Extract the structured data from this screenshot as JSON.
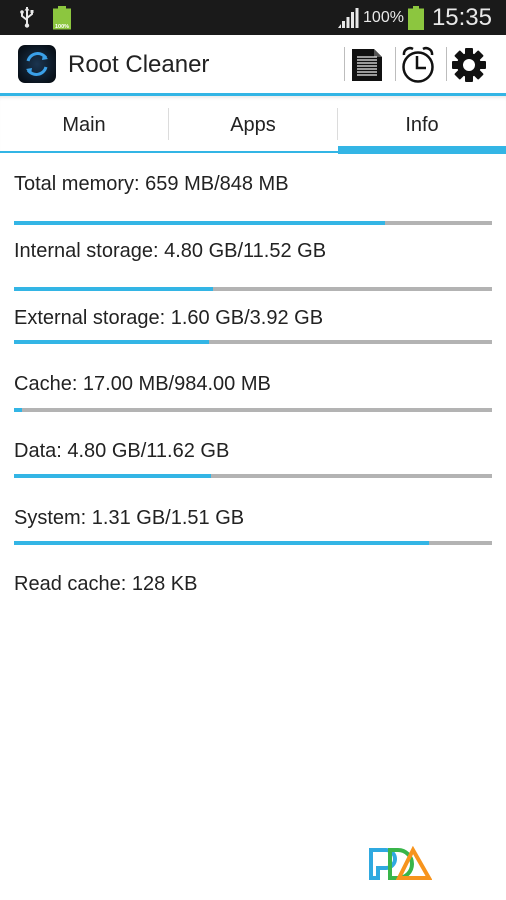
{
  "status_bar": {
    "notification_icons": [
      "usb-icon",
      "battery-notification-icon"
    ],
    "small_battery_label": "100%",
    "signal_icon": "signal-icon",
    "battery_percent": "100%",
    "battery_icon": "battery-icon",
    "time": "15:35"
  },
  "action_bar": {
    "app_icon": "root-cleaner-app-icon",
    "title": "Root Cleaner",
    "actions": [
      {
        "name": "log",
        "icon": "document-icon"
      },
      {
        "name": "schedule",
        "icon": "alarm-clock-icon"
      },
      {
        "name": "settings",
        "icon": "gear-icon"
      }
    ]
  },
  "tabs": [
    {
      "label": "Main",
      "selected": false
    },
    {
      "label": "Apps",
      "selected": false
    },
    {
      "label": "Info",
      "selected": true
    }
  ],
  "colors": {
    "accent": "#33b5e5",
    "track": "#b3b3b3",
    "status_bar": "#1a1a1a",
    "battery_green": "#8cc63f"
  },
  "info": {
    "items": [
      {
        "label": "Total memory: 659 MB/848 MB",
        "progress": 0.777
      },
      {
        "label": "Internal storage: 4.80 GB/11.52 GB",
        "progress": 0.417
      },
      {
        "label": "External storage: 1.60 GB/3.92 GB",
        "progress": 0.408
      },
      {
        "label": "Cache: 17.00 MB/984.00 MB",
        "progress": 0.017
      },
      {
        "label": "Data: 4.80 GB/11.62 GB",
        "progress": 0.413
      },
      {
        "label": "System: 1.31 GB/1.51 GB",
        "progress": 0.868
      }
    ],
    "read_cache": "Read cache: 128 KB"
  },
  "watermark": {
    "icon": "pda-logo-icon"
  }
}
